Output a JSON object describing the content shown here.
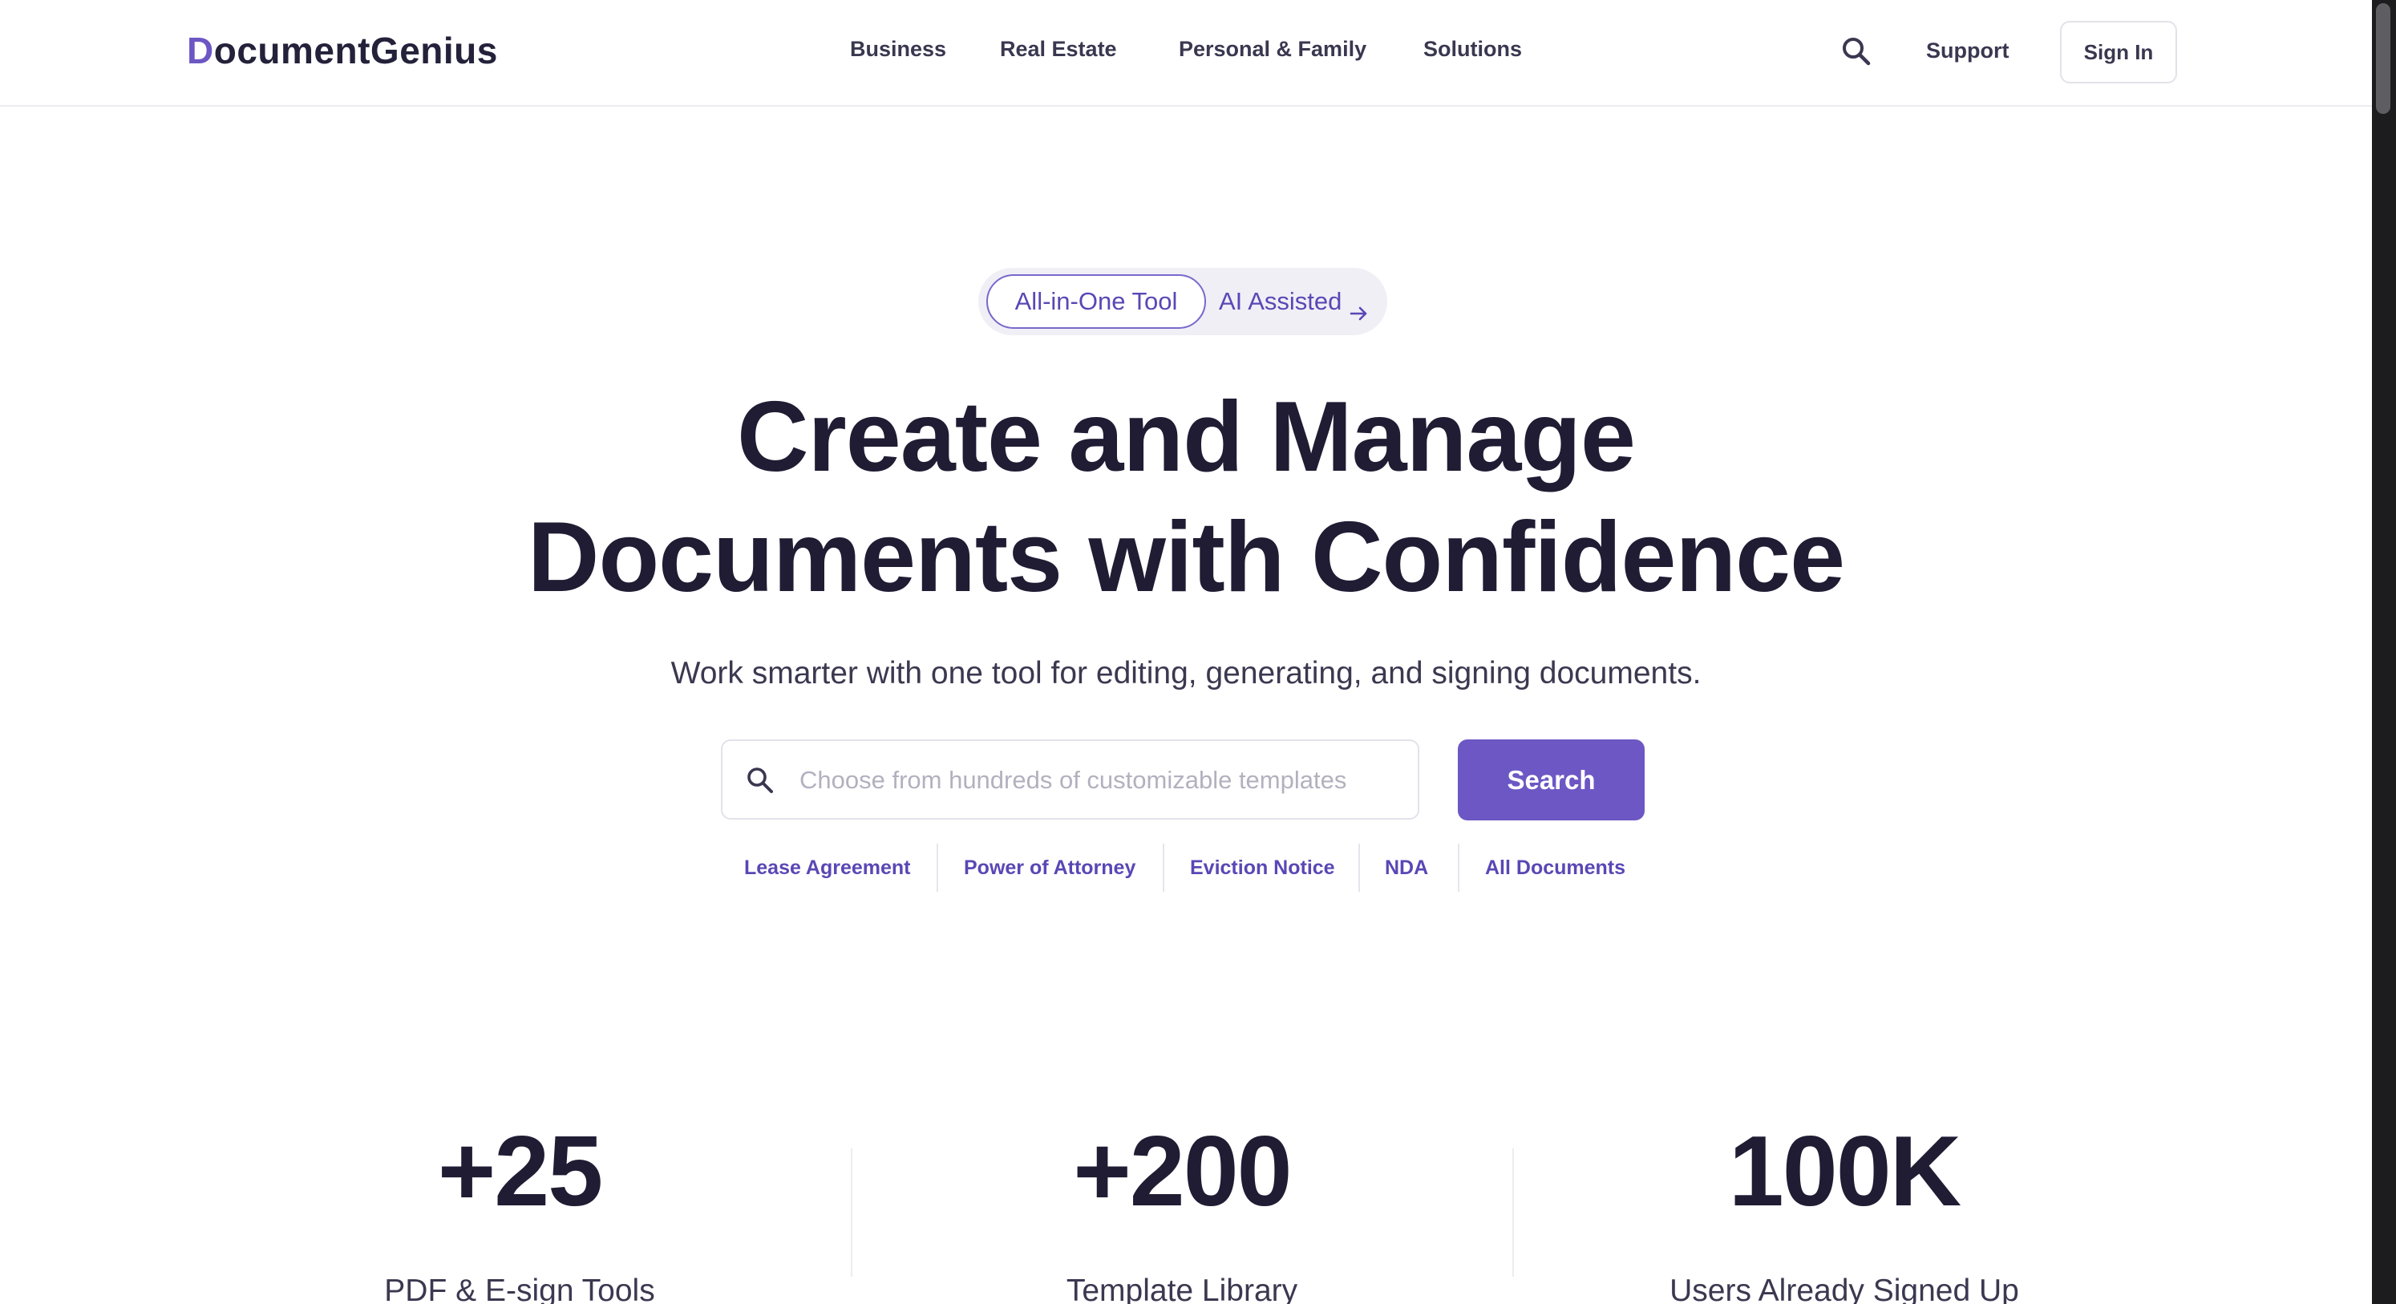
{
  "header": {
    "logo_first": "D",
    "logo_rest": "ocumentGenius",
    "nav": [
      "Business",
      "Real Estate",
      "Personal & Family",
      "Solutions"
    ],
    "support_label": "Support",
    "signin_label": "Sign In"
  },
  "hero": {
    "pill_active": "All-in-One Tool",
    "pill_secondary": "AI Assisted",
    "title_line1": "Create and Manage",
    "title_line2": "Documents with Confidence",
    "subtitle": "Work smarter with one tool for editing, generating, and signing documents."
  },
  "search": {
    "placeholder": "Choose from hundreds of customizable templates",
    "value": "",
    "button_label": "Search"
  },
  "quick_links": [
    "Lease Agreement",
    "Power of Attorney",
    "Eviction Notice",
    "NDA",
    "All Documents"
  ],
  "stats": [
    {
      "value": "+25",
      "label": "PDF & E-sign Tools"
    },
    {
      "value": "+200",
      "label": "Template Library"
    },
    {
      "value": "100K",
      "label": "Users Already Signed Up"
    }
  ],
  "colors": {
    "accent": "#6d57c4",
    "heading": "#1f1c33",
    "body_text": "#3b3850",
    "link": "#5a47b5"
  },
  "icons": {
    "header_search": "search-icon",
    "pill_arrow": "arrow-right-icon",
    "search_box": "search-icon"
  }
}
